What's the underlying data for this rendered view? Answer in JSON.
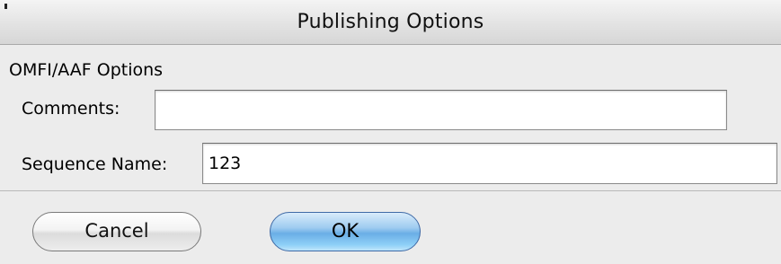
{
  "window": {
    "title": "Publishing Options"
  },
  "group": {
    "label": "OMFI/AAF Options"
  },
  "fields": {
    "comments": {
      "label": "Comments:",
      "value": ""
    },
    "sequence_name": {
      "label": "Sequence Name:",
      "value": "123"
    }
  },
  "buttons": {
    "cancel_label": "Cancel",
    "ok_label": "OK"
  }
}
